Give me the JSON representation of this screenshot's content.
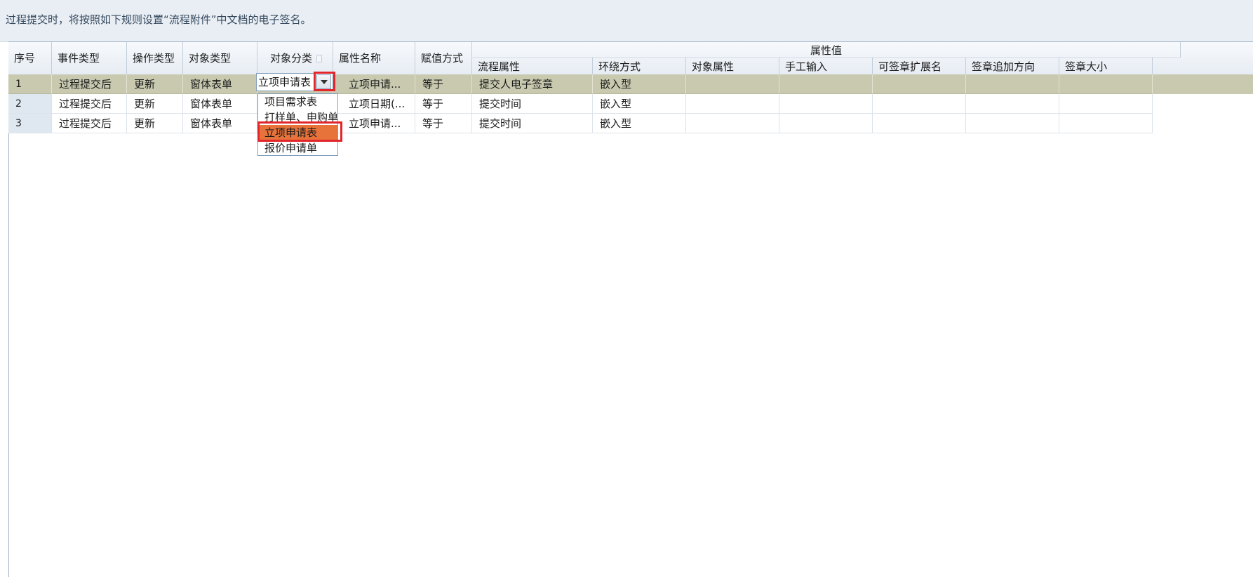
{
  "info_text": "过程提交时，将按照如下规则设置“流程附件”中文档的电子签名。",
  "columns": {
    "seq": "序号",
    "event_type": "事件类型",
    "op_type": "操作类型",
    "obj_type": "对象类型",
    "obj_category": "对象分类",
    "attr_name": "属性名称",
    "assign_method": "赋值方式",
    "attr_value_group": "属性值",
    "flow_attr": "流程属性",
    "wrap_mode": "环绕方式",
    "obj_attr": "对象属性",
    "manual_input": "手工输入",
    "sign_ext": "可签章扩展名",
    "sign_direction": "签章追加方向",
    "sign_size": "签章大小"
  },
  "rows": [
    {
      "seq": "1",
      "event_type": "过程提交后",
      "op_type": "更新",
      "obj_type": "窗体表单",
      "obj_category": "立项申请表",
      "attr_name": "立项申请...",
      "assign_method": "等于",
      "flow_attr": "提交人电子签章",
      "wrap_mode": "嵌入型",
      "obj_attr": "",
      "manual_input": "",
      "sign_ext": "",
      "sign_direction": "",
      "sign_size": ""
    },
    {
      "seq": "2",
      "event_type": "过程提交后",
      "op_type": "更新",
      "obj_type": "窗体表单",
      "obj_category": "",
      "attr_name": "立项日期(...",
      "assign_method": "等于",
      "flow_attr": "提交时间",
      "wrap_mode": "嵌入型",
      "obj_attr": "",
      "manual_input": "",
      "sign_ext": "",
      "sign_direction": "",
      "sign_size": ""
    },
    {
      "seq": "3",
      "event_type": "过程提交后",
      "op_type": "更新",
      "obj_type": "窗体表单",
      "obj_category": "",
      "attr_name": "立项申请...",
      "assign_method": "等于",
      "flow_attr": "提交时间",
      "wrap_mode": "嵌入型",
      "obj_attr": "",
      "manual_input": "",
      "sign_ext": "",
      "sign_direction": "",
      "sign_size": ""
    }
  ],
  "editor": {
    "value": "立项申请表",
    "icon": "chevron-down-icon"
  },
  "dropdown_options": [
    "项目需求表",
    "打样单、申购单",
    "立项申请表",
    "报价申请单"
  ],
  "selected_option": "立项申请表",
  "colors": {
    "selected_row": "#c9c9b0",
    "highlight_box": "#e1262c",
    "active_option": "#e8733a"
  }
}
